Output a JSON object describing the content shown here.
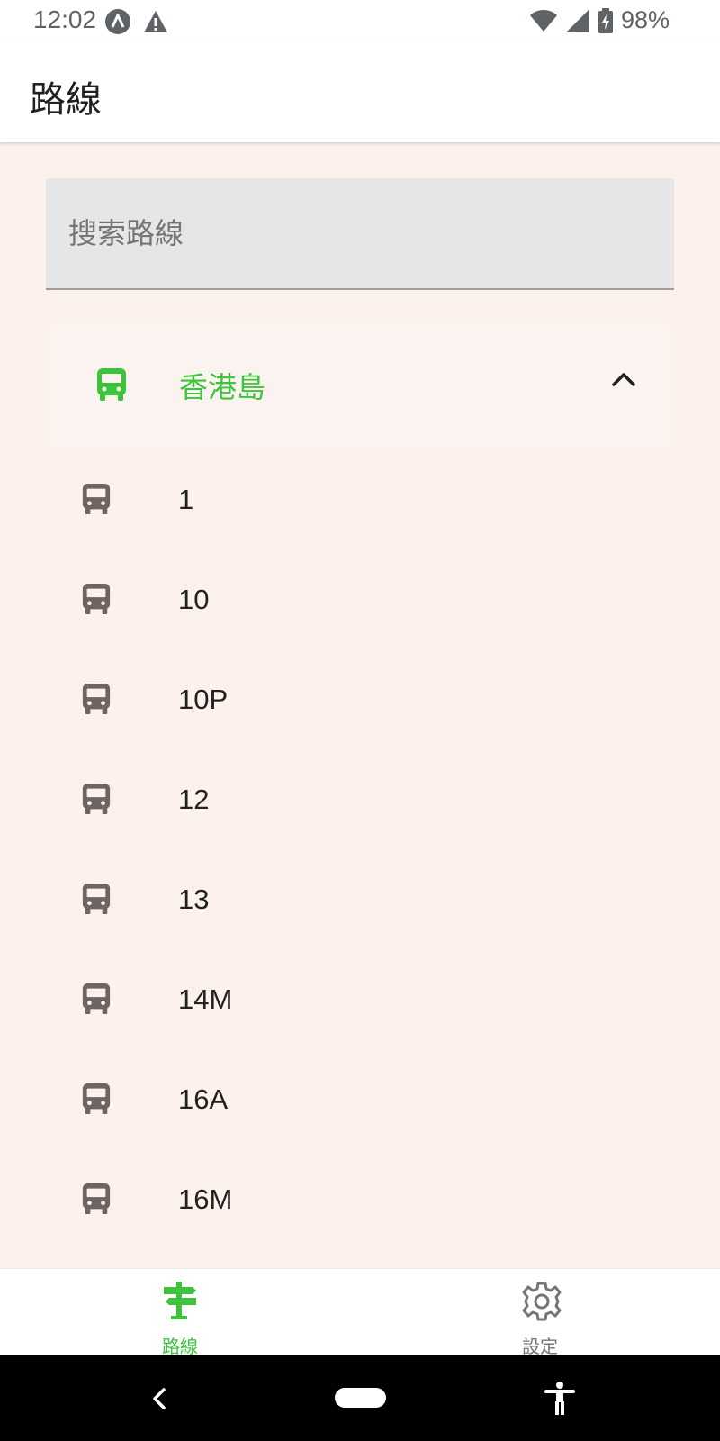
{
  "status_bar": {
    "time": "12:02",
    "battery": "98%",
    "left_icons": [
      "notification-a-icon",
      "warning-icon"
    ],
    "right_icons": [
      "wifi-icon",
      "cellular-signal-icon",
      "battery-charging-icon"
    ]
  },
  "app_bar": {
    "title": "路線"
  },
  "search": {
    "placeholder": "搜索路線",
    "value": ""
  },
  "region": {
    "label": "香港島",
    "expanded": true,
    "accent_color": "#3cc53c"
  },
  "routes": [
    {
      "label": "1"
    },
    {
      "label": "10"
    },
    {
      "label": "10P"
    },
    {
      "label": "12"
    },
    {
      "label": "13"
    },
    {
      "label": "14M"
    },
    {
      "label": "16A"
    },
    {
      "label": "16M"
    }
  ],
  "bottom_nav": {
    "items": [
      {
        "label": "路線",
        "icon": "signpost-icon",
        "active": true
      },
      {
        "label": "設定",
        "icon": "gear-icon",
        "active": false
      }
    ]
  },
  "colors": {
    "background": "#fdf1eb",
    "accent": "#3cc53c",
    "route_icon": "#6d6463"
  }
}
